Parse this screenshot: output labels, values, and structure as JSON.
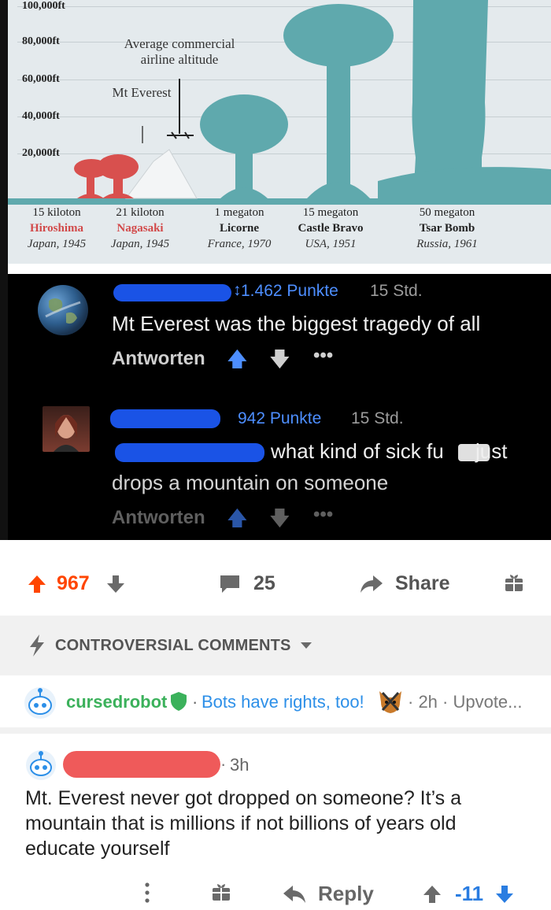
{
  "infographic": {
    "altitude_labels": [
      "100,000ft",
      "80,000ft",
      "60,000ft",
      "40,000ft",
      "20,000ft"
    ],
    "airline_label": "Average commercial airline altitude",
    "everest_label": "Mt Everest",
    "bombs": [
      {
        "yield": "15 kiloton",
        "name": "Hiroshima",
        "place": "Japan, 1945",
        "color": "#d24a4a"
      },
      {
        "yield": "21 kiloton",
        "name": "Nagasaki",
        "place": "Japan, 1945",
        "color": "#d24a4a"
      },
      {
        "yield": "1 megaton",
        "name": "Licorne",
        "place": "France, 1970",
        "color": "#222222"
      },
      {
        "yield": "15 megaton",
        "name": "Castle Bravo",
        "place": "USA, 1951",
        "color": "#222222"
      },
      {
        "yield": "50 megaton",
        "name": "Tsar Bomb",
        "place": "Russia, 1961",
        "color": "#222222"
      }
    ],
    "cloud_color_small": "#d8504e",
    "cloud_color_large": "#5fa9ad"
  },
  "dark_thread": {
    "comment1": {
      "points": "1.462 Punkte",
      "time": "15 Std.",
      "text": "Mt Everest was the biggest tragedy of all",
      "reply": "Antworten"
    },
    "comment2": {
      "points": "942 Punkte",
      "time": "15 Std.",
      "text_line1": "what kind of sick fu",
      "text_line1_end": "just",
      "text_line2": "drops a mountain on someone",
      "reply": "Antworten"
    }
  },
  "post_actions": {
    "upvotes": "967",
    "comments": "25",
    "share": "Share"
  },
  "sort": {
    "label": "CONTROVERSIAL COMMENTS"
  },
  "mod_comment": {
    "user": "cursedrobot",
    "flair": "Bots have rights, too!",
    "meta": "· 2h · Upvote..."
  },
  "top_comment": {
    "time": "3h",
    "text": "Mt. Everest never got dropped on someone? It’s a mountain that is millions if not billions of years old educate yourself",
    "reply": "Reply",
    "score": "-11"
  },
  "colors": {
    "upvote": "#ff4500",
    "downvote": "#2a7de1",
    "mod_green": "#3bb15b",
    "user_blue": "#2c8fe8",
    "redact_blue": "#1a53e6",
    "redact_red": "#ef5a5a"
  }
}
